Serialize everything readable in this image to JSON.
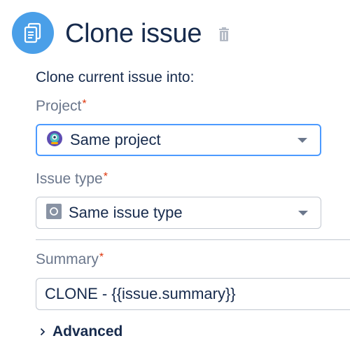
{
  "header": {
    "title": "Clone issue",
    "icon": "clone-icon",
    "delete_icon": "trash-icon"
  },
  "form": {
    "intro": "Clone current issue into:",
    "project": {
      "label": "Project",
      "required_mark": "*",
      "value": "Same project",
      "icon": "project-avatar-icon"
    },
    "issue_type": {
      "label": "Issue type",
      "required_mark": "*",
      "value": "Same issue type",
      "icon": "issue-type-icon"
    },
    "summary": {
      "label": "Summary",
      "required_mark": "*",
      "value": "CLONE - {{issue.summary}}"
    },
    "advanced": {
      "label": "Advanced",
      "icon": "chevron-right-icon"
    }
  },
  "colors": {
    "accent": "#4a9fe8",
    "focus": "#4c9aff",
    "required": "#de350b"
  }
}
